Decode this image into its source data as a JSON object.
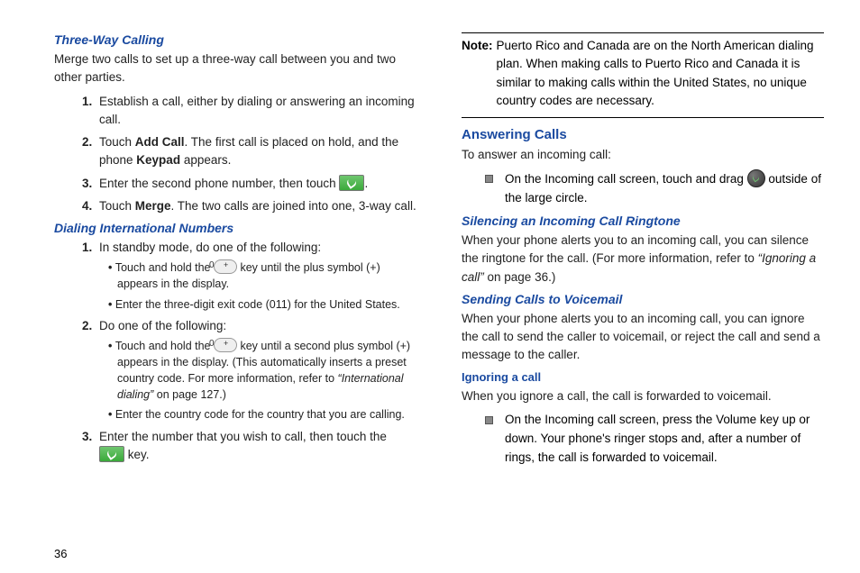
{
  "page_number": "36",
  "left": {
    "h_three_way": "Three-Way Calling",
    "three_way_intro": "Merge two calls to set up a three-way call between you and two other parties.",
    "tw_steps": {
      "s1": "Establish a call, either by dialing or answering an incoming call.",
      "s2_a": "Touch ",
      "s2_b": "Add Call",
      "s2_c": ". The first call is placed on hold, and the phone ",
      "s2_d": "Keypad",
      "s2_e": " appears.",
      "s3_a": "Enter the second phone number, then touch ",
      "s3_b": ".",
      "s4_a": "Touch ",
      "s4_b": "Merge",
      "s4_c": ". The two calls are joined into one, 3-way call."
    },
    "h_intl": "Dialing International Numbers",
    "intl": {
      "s1": "In standby mode, do one of the following:",
      "s1_b1_a": "Touch and hold the ",
      "s1_b1_b": " key until the plus symbol (+) appears in the display.",
      "s1_b2": "Enter the three-digit exit code (011) for the United States.",
      "s2": "Do one of the following:",
      "s2_b1_a": "Touch and hold the ",
      "s2_b1_b": " key until a second plus symbol (+) appears in the display. (This automatically inserts a preset country code. For more information, refer to ",
      "s2_b1_c": "“International dialing”",
      "s2_b1_d": "  on page 127.)",
      "s2_b2": "Enter the country code for the country that you are calling.",
      "s3_a": "Enter the number that you wish to call, then touch the ",
      "s3_b": " key."
    }
  },
  "right": {
    "note_label": "Note:",
    "note_body": "Puerto Rico and Canada are on the North American dialing plan. When making calls to Puerto Rico and Canada it is similar to making calls within the United States, no unique country codes are necessary.",
    "h_answer": "Answering Calls",
    "answer_intro": "To answer an incoming call:",
    "answer_b_a": "On the Incoming call screen, touch and drag ",
    "answer_b_b": " outside of the large circle.",
    "h_silence": "Silencing an Incoming Call Ringtone",
    "silence_a": "When your phone alerts you to an incoming call, you can silence the ringtone for the call. (For more information, refer to ",
    "silence_b": "“Ignoring a call”",
    "silence_c": "  on page 36.)",
    "h_voicemail": "Sending Calls to Voicemail",
    "voicemail_body": "When your phone alerts you to an incoming call, you can ignore the call to send the caller to voicemail, or reject the call and send a message to the caller.",
    "h_ignore": "Ignoring a call",
    "ignore_body": "When you ignore a call, the call is forwarded to voicemail.",
    "ignore_b": "On the Incoming call screen, press the Volume key up or down. Your phone's ringer stops and, after a number of rings, the call is forwarded to voicemail."
  }
}
